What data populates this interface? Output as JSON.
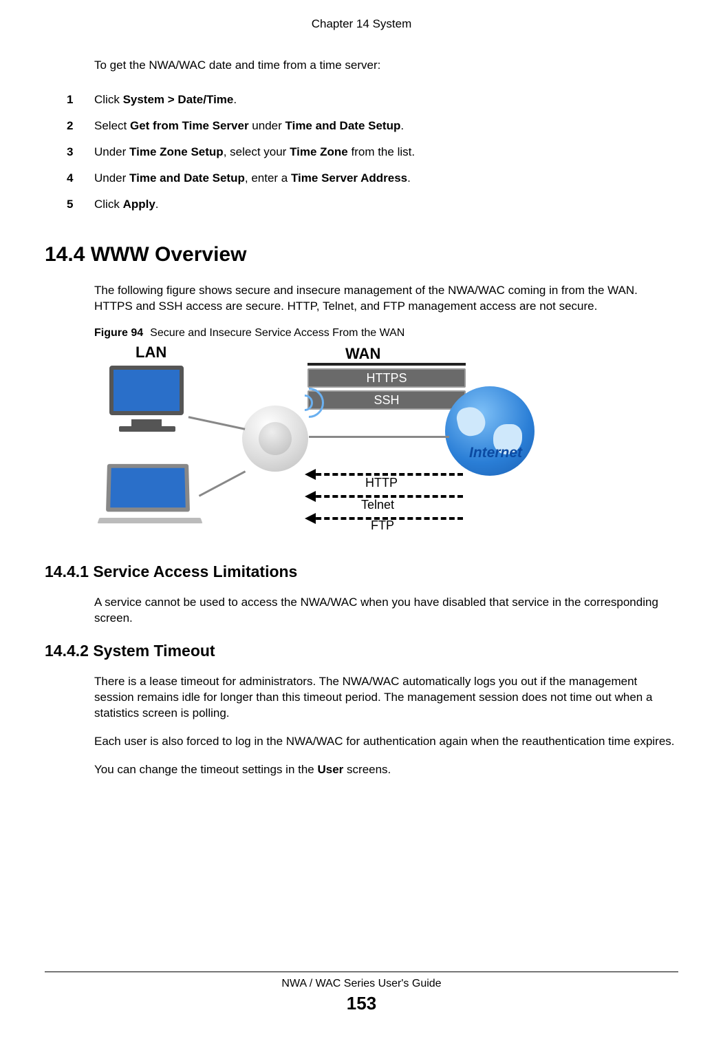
{
  "header": {
    "chapter": "Chapter 14 System"
  },
  "intro": "To get the NWA/WAC date and time from a time server:",
  "steps": [
    {
      "num": "1",
      "pre": "Click ",
      "b1": "System > Date/Time",
      "post": "."
    },
    {
      "num": "2",
      "pre": "Select ",
      "b1": "Get from Time Server",
      "mid": " under ",
      "b2": "Time and Date Setup",
      "post": "."
    },
    {
      "num": "3",
      "pre": "Under ",
      "b1": "Time Zone Setup",
      "mid": ", select your ",
      "b2": "Time Zone",
      "post": " from the list."
    },
    {
      "num": "4",
      "pre": "Under ",
      "b1": "Time and Date Setup",
      "mid": ", enter a ",
      "b2": "Time Server Address",
      "post": "."
    },
    {
      "num": "5",
      "pre": "Click ",
      "b1": "Apply",
      "post": "."
    }
  ],
  "s14_4": {
    "heading": "14.4  WWW Overview",
    "para": "The following figure shows secure and insecure management of the NWA/WAC coming in from the WAN. HTTPS and SSH access are secure. HTTP, Telnet, and FTP management access are not secure.",
    "figure": {
      "label": "Figure 94",
      "caption": "Secure and Insecure Service Access From the WAN",
      "lan": "LAN",
      "wan": "WAN",
      "https": "HTTPS",
      "ssh": "SSH",
      "internet": "Internet",
      "http": "HTTP",
      "telnet": "Telnet",
      "ftp": "FTP"
    }
  },
  "s14_4_1": {
    "heading": "14.4.1  Service Access Limitations",
    "para": "A service cannot be used to access the NWA/WAC when you have disabled that service in the corresponding screen."
  },
  "s14_4_2": {
    "heading": "14.4.2  System Timeout",
    "p1": "There is a lease timeout for administrators. The NWA/WAC automatically logs you out if the management session remains idle for longer than this timeout period. The management session does not time out when a statistics screen is polling.",
    "p2": "Each user is also forced to log in the NWA/WAC for authentication again when the reauthentication time expires.",
    "p3_pre": "You can change the timeout settings in the ",
    "p3_b": "User",
    "p3_post": " screens."
  },
  "footer": {
    "title": "NWA / WAC Series User's Guide",
    "page": "153"
  }
}
